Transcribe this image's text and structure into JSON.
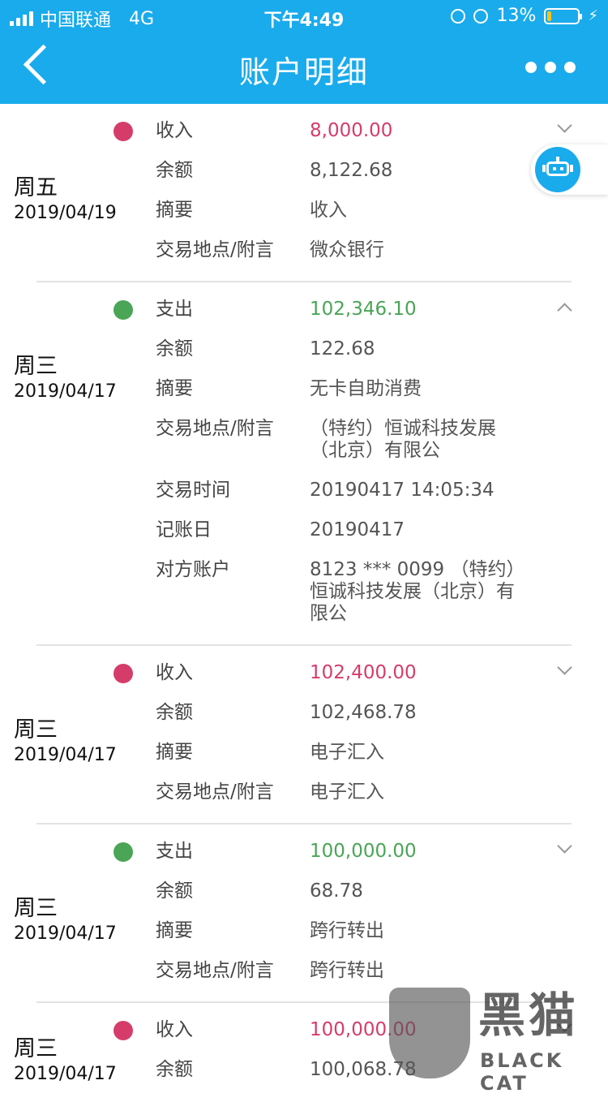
{
  "status_bar": {
    "carrier": "中国联通",
    "network": "4G",
    "time": "下午4:49",
    "battery": "13%",
    "battery_level": 0.13
  },
  "nav": {
    "title": "账户明细",
    "back_icon": "chevron-left-icon",
    "more_icon": "more-dots-icon"
  },
  "colors": {
    "header": "#1aabec",
    "income": "#d63c6a",
    "expense": "#4aa556"
  },
  "records": [
    {
      "day": "周五",
      "date": "2019/04/19",
      "type": "income",
      "expanded": false,
      "rows": [
        {
          "label": "收入",
          "value": "8,000.00"
        },
        {
          "label": "余额",
          "value": "8,122.68"
        },
        {
          "label": "摘要",
          "value": "收入"
        },
        {
          "label": "交易地点/附言",
          "value": "微众银行"
        }
      ]
    },
    {
      "day": "周三",
      "date": "2019/04/17",
      "type": "expense",
      "expanded": true,
      "rows": [
        {
          "label": "支出",
          "value": "102,346.10"
        },
        {
          "label": "余额",
          "value": "122.68"
        },
        {
          "label": "摘要",
          "value": "无卡自助消费"
        },
        {
          "label": "交易地点/附言",
          "value": "（特约）恒诚科技发展\n（北京）有限公"
        },
        {
          "label": "交易时间",
          "value": "20190417 14:05:34"
        },
        {
          "label": "记账日",
          "value": "20190417"
        },
        {
          "label": "对方账户",
          "value": "8123 *** 0099 （特约）\n恒诚科技发展（北京）有\n限公"
        }
      ]
    },
    {
      "day": "周三",
      "date": "2019/04/17",
      "type": "income",
      "expanded": false,
      "rows": [
        {
          "label": "收入",
          "value": "102,400.00"
        },
        {
          "label": "余额",
          "value": "102,468.78"
        },
        {
          "label": "摘要",
          "value": "电子汇入"
        },
        {
          "label": "交易地点/附言",
          "value": "电子汇入"
        }
      ]
    },
    {
      "day": "周三",
      "date": "2019/04/17",
      "type": "expense",
      "expanded": false,
      "rows": [
        {
          "label": "支出",
          "value": "100,000.00"
        },
        {
          "label": "余额",
          "value": "68.78"
        },
        {
          "label": "摘要",
          "value": "跨行转出"
        },
        {
          "label": "交易地点/附言",
          "value": "跨行转出"
        }
      ]
    },
    {
      "day": "周三",
      "date": "2019/04/17",
      "type": "income",
      "expanded": false,
      "rows": [
        {
          "label": "收入",
          "value": "100,000.00"
        },
        {
          "label": "余额",
          "value": "100,068.78"
        }
      ]
    }
  ],
  "assistant": {
    "icon": "robot-icon"
  },
  "watermark": {
    "cn": "黑猫",
    "en": "BLACK CAT",
    "icon": "cat-shield-icon"
  }
}
